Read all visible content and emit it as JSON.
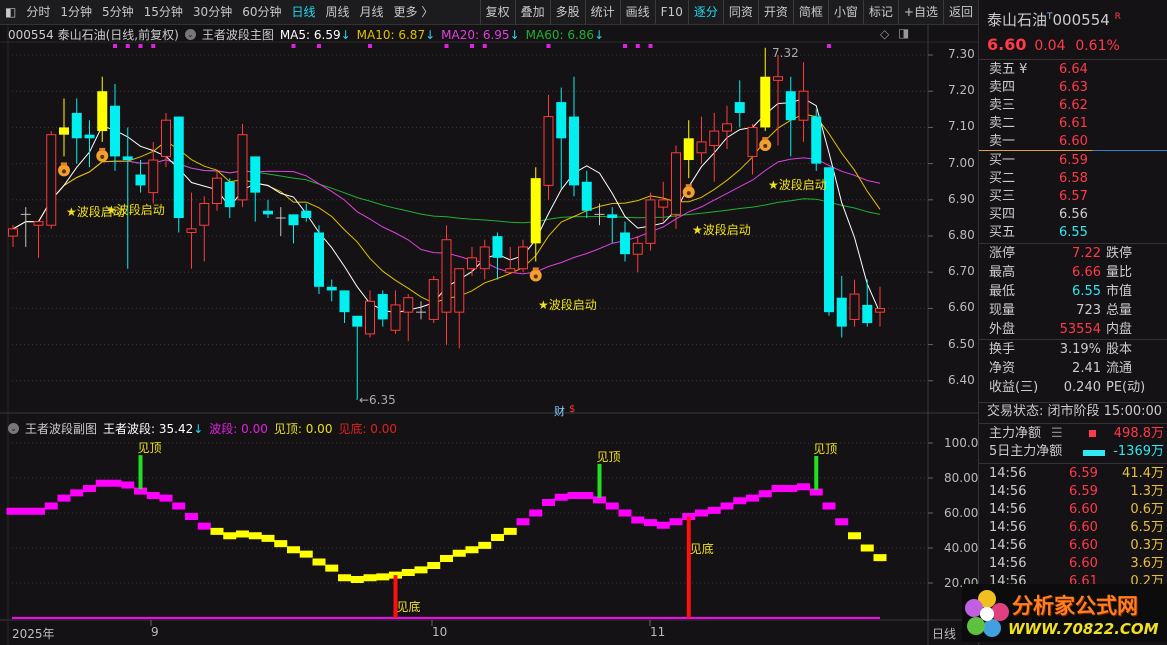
{
  "toolbar": {
    "items": [
      "分时",
      "1分钟",
      "5分钟",
      "15分钟",
      "30分钟",
      "60分钟",
      "日线",
      "周线",
      "月线",
      "更多 〉"
    ],
    "active": "日线",
    "buttons": [
      "复权",
      "叠加",
      "多股",
      "统计",
      "画线",
      "F10",
      "逐分",
      "同资",
      "开资",
      "简框",
      "小窗",
      "标记",
      "+自选",
      "返回"
    ],
    "active_button": "逐分"
  },
  "main_header": {
    "title": "000554 泰山石油(日线,前复权)",
    "indicator": "王者波段主图",
    "ma5": "MA5: 6.59",
    "ma10": "MA10: 6.87",
    "ma20": "MA20: 6.95",
    "ma60": "MA60: 6.86",
    "arrow": "↓"
  },
  "sub_header": {
    "indicator": "王者波段副图",
    "wave": "王者波段: 35.42",
    "band": "波段: 0.00",
    "top": "见顶: 0.00",
    "bottom": "见底: 0.00",
    "arrow": "↓"
  },
  "annotations": {
    "wave_start": "★波段启动",
    "top": "见顶",
    "bottom": "见底",
    "low_mark": "←6.35",
    "high_mark": "7.32",
    "finance": "财",
    "finance_sub": "$"
  },
  "x_axis": {
    "labels": [
      "2025年",
      "9",
      "10",
      "11"
    ],
    "period": "日线"
  },
  "colors": {
    "up": "#ff3a3a",
    "down": "#00f0f0",
    "signal": "#ffff00",
    "cross": "#c0c0c0",
    "ma5": "#ffffff",
    "ma10": "#e0c000",
    "ma20": "#e040e0",
    "ma60": "#20b030",
    "wave_high": "#ff00ff",
    "wave_low": "#ffff00"
  },
  "chart_data": [
    {
      "type": "candlestick",
      "title": "000554 泰山石油 日线",
      "ylim": [
        6.3,
        7.35
      ],
      "yticks": [
        "7.30",
        "7.20",
        "7.10",
        "7.00",
        "6.90",
        "6.80",
        "6.70",
        "6.60",
        "6.50",
        "6.40"
      ],
      "ohlc": [
        [
          6.8,
          6.83,
          6.77,
          6.82
        ],
        [
          6.86,
          6.88,
          6.77,
          6.86
        ],
        [
          6.83,
          6.84,
          6.74,
          6.84
        ],
        [
          6.83,
          7.09,
          6.82,
          7.08
        ],
        [
          7.08,
          7.18,
          7.02,
          7.1,
          "s"
        ],
        [
          7.14,
          7.18,
          7.0,
          7.07
        ],
        [
          7.08,
          7.12,
          6.99,
          7.07
        ],
        [
          7.09,
          7.24,
          7.06,
          7.2,
          "s"
        ],
        [
          7.16,
          7.22,
          6.98,
          7.02
        ],
        [
          7.02,
          7.1,
          6.71,
          7.01
        ],
        [
          6.97,
          7.01,
          6.92,
          6.94
        ],
        [
          6.92,
          7.06,
          6.89,
          7.01
        ],
        [
          7.02,
          7.14,
          6.99,
          7.12
        ],
        [
          7.13,
          7.13,
          6.81,
          6.85
        ],
        [
          6.81,
          6.92,
          6.71,
          6.82
        ],
        [
          6.83,
          6.91,
          6.73,
          6.89
        ],
        [
          6.89,
          6.98,
          6.87,
          6.96
        ],
        [
          6.95,
          6.96,
          6.85,
          6.88
        ],
        [
          6.9,
          7.11,
          6.88,
          7.08
        ],
        [
          7.02,
          7.02,
          6.84,
          6.92
        ],
        [
          6.87,
          6.9,
          6.85,
          6.86
        ],
        [
          6.85,
          6.88,
          6.8,
          6.85
        ],
        [
          6.86,
          6.86,
          6.78,
          6.83
        ],
        [
          6.87,
          6.89,
          6.84,
          6.85
        ],
        [
          6.81,
          6.83,
          6.64,
          6.66
        ],
        [
          6.66,
          6.68,
          6.62,
          6.65
        ],
        [
          6.65,
          6.65,
          6.56,
          6.59
        ],
        [
          6.58,
          6.58,
          6.35,
          6.55
        ],
        [
          6.53,
          6.65,
          6.52,
          6.62
        ],
        [
          6.64,
          6.65,
          6.55,
          6.57
        ],
        [
          6.54,
          6.65,
          6.53,
          6.61
        ],
        [
          6.59,
          6.64,
          6.51,
          6.63
        ],
        [
          6.59,
          6.62,
          6.57,
          6.59
        ],
        [
          6.57,
          6.69,
          6.56,
          6.68
        ],
        [
          6.59,
          6.83,
          6.5,
          6.79
        ],
        [
          6.59,
          6.71,
          6.49,
          6.71
        ],
        [
          6.71,
          6.77,
          6.69,
          6.74
        ],
        [
          6.71,
          6.79,
          6.68,
          6.77
        ],
        [
          6.8,
          6.81,
          6.68,
          6.74
        ],
        [
          6.7,
          6.77,
          6.7,
          6.71
        ],
        [
          6.71,
          6.79,
          6.7,
          6.77
        ],
        [
          6.78,
          6.99,
          6.73,
          6.96,
          "s"
        ],
        [
          6.94,
          7.19,
          6.9,
          7.13
        ],
        [
          7.17,
          7.21,
          6.93,
          7.07
        ],
        [
          7.13,
          7.24,
          6.91,
          6.94
        ],
        [
          6.95,
          6.98,
          6.85,
          6.87
        ],
        [
          6.86,
          6.89,
          6.83,
          6.86
        ],
        [
          6.86,
          6.88,
          6.78,
          6.85
        ],
        [
          6.81,
          6.84,
          6.73,
          6.75
        ],
        [
          6.75,
          6.8,
          6.7,
          6.78
        ],
        [
          6.78,
          6.92,
          6.76,
          6.9
        ],
        [
          6.88,
          6.95,
          6.84,
          6.9
        ],
        [
          6.86,
          7.05,
          6.82,
          7.03
        ],
        [
          7.01,
          7.12,
          6.96,
          7.07,
          "s"
        ],
        [
          7.03,
          7.13,
          7.0,
          7.06
        ],
        [
          7.05,
          7.14,
          6.95,
          7.09
        ],
        [
          7.09,
          7.16,
          7.04,
          7.11
        ],
        [
          7.17,
          7.23,
          7.1,
          7.14
        ],
        [
          7.02,
          7.11,
          6.97,
          7.1
        ],
        [
          7.1,
          7.32,
          7.09,
          7.24,
          "s"
        ],
        [
          7.23,
          7.3,
          7.05,
          7.24
        ],
        [
          7.2,
          7.24,
          7.02,
          7.12
        ],
        [
          7.12,
          7.28,
          7.06,
          7.2
        ],
        [
          7.13,
          7.15,
          6.98,
          7.0
        ],
        [
          6.99,
          6.99,
          6.58,
          6.59
        ],
        [
          6.63,
          6.69,
          6.52,
          6.55
        ],
        [
          6.57,
          6.68,
          6.55,
          6.64
        ],
        [
          6.61,
          6.68,
          6.55,
          6.56
        ],
        [
          6.59,
          6.66,
          6.55,
          6.6
        ]
      ],
      "wave_start_at": [
        4,
        7,
        41,
        53,
        59
      ],
      "moneybag_at": [
        4,
        7,
        41,
        53,
        59
      ],
      "top_dots_at": [
        8,
        9,
        10,
        11,
        22,
        24,
        28,
        34,
        36,
        37,
        42,
        48,
        49,
        50,
        64
      ]
    },
    {
      "type": "step",
      "title": "王者波段副图",
      "ylim": [
        0,
        105
      ],
      "yticks": [
        "100.0",
        "80.00",
        "60.00",
        "40.00",
        "20.00"
      ],
      "threshold": 50,
      "values": [
        61,
        61,
        61,
        64,
        68.5,
        71.5,
        74,
        77,
        77,
        76,
        72.5,
        70,
        68.5,
        64,
        58,
        52.5,
        49.5,
        47,
        48,
        47,
        45.5,
        42.5,
        39,
        36.5,
        32,
        28.5,
        23,
        22,
        23,
        23.5,
        24.5,
        26,
        27.5,
        30,
        34,
        37,
        39,
        41.5,
        46,
        49.5,
        55,
        60,
        66,
        69,
        70,
        70,
        67.5,
        64,
        60,
        56,
        54.5,
        53,
        55,
        58,
        60,
        61.5,
        64,
        67,
        68.5,
        71,
        74,
        74,
        75,
        72,
        64,
        55,
        47,
        40,
        34.5
      ],
      "band_magenta_until": 16,
      "top_signals": [
        10,
        46,
        63
      ],
      "bottom_signals": [
        30,
        53
      ]
    }
  ],
  "quote": {
    "name": "泰山石油",
    "t": "T",
    "code": "000554",
    "r": "R",
    "price": "6.60",
    "change": "0.04",
    "pct": "0.61%",
    "asks": [
      {
        "label": "卖五 ¥",
        "price": "6.64"
      },
      {
        "label": "卖四",
        "price": "6.63"
      },
      {
        "label": "卖三",
        "price": "6.62"
      },
      {
        "label": "卖二",
        "price": "6.61"
      },
      {
        "label": "卖一",
        "price": "6.60"
      }
    ],
    "bids": [
      {
        "label": "买一",
        "price": "6.59"
      },
      {
        "label": "买二",
        "price": "6.58"
      },
      {
        "label": "买三",
        "price": "6.57"
      },
      {
        "label": "买四",
        "price": "6.56"
      },
      {
        "label": "买五",
        "price": "6.55"
      }
    ],
    "stats": [
      {
        "l": "涨停",
        "v": "7.22",
        "r": "跌停"
      },
      {
        "l": "最高",
        "v": "6.66",
        "r": "量比"
      },
      {
        "l": "最低",
        "v": "6.55",
        "r": "市值"
      },
      {
        "l": "现量",
        "v": "723",
        "r": "总量"
      },
      {
        "l": "外盘",
        "v": "53554",
        "r": "内盘"
      }
    ],
    "stats2": [
      {
        "l": "换手",
        "v": "3.19%",
        "r": "股本"
      },
      {
        "l": "净资",
        "v": "2.41",
        "r": "流通"
      },
      {
        "l": "收益(三)",
        "v": "0.240",
        "r": "PE(动)"
      }
    ],
    "status": "交易状态: 闭市阶段 15:00:00",
    "main_net": {
      "label": "主力净额",
      "value": "498.8万"
    },
    "main_net5": {
      "label": "5日主力净额",
      "value": "-1369万"
    },
    "ticks": [
      {
        "t": "14:56",
        "p": "6.59",
        "v": "41.4万"
      },
      {
        "t": "14:56",
        "p": "6.59",
        "v": "1.3万"
      },
      {
        "t": "14:56",
        "p": "6.60",
        "v": "0.6万"
      },
      {
        "t": "14:56",
        "p": "6.60",
        "v": "6.5万"
      },
      {
        "t": "14:56",
        "p": "6.60",
        "v": "0.3万"
      },
      {
        "t": "14:56",
        "p": "6.60",
        "v": "3.6万"
      },
      {
        "t": "14:56",
        "p": "6.61",
        "v": "0.2万"
      }
    ]
  },
  "watermark": {
    "name": "分析家公式网",
    "url": "WWW.70822.COM"
  }
}
